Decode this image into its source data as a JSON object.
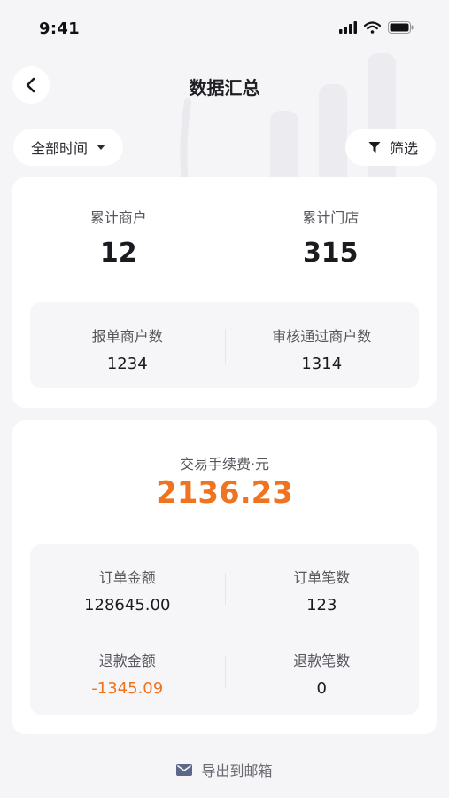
{
  "status_bar": {
    "time": "9:41"
  },
  "header": {
    "title": "数据汇总"
  },
  "filters": {
    "time_range": "全部时间",
    "filter_label": "筛选"
  },
  "summary": {
    "total_merchants_label": "累计商户",
    "total_merchants_value": "12",
    "total_stores_label": "累计门店",
    "total_stores_value": "315",
    "submitted_label": "报单商户数",
    "submitted_value": "1234",
    "approved_label": "审核通过商户数",
    "approved_value": "1314"
  },
  "transactions": {
    "fee_label": "交易手续费·元",
    "fee_value": "2136.23",
    "order_amount_label": "订单金额",
    "order_amount_value": "128645.00",
    "order_count_label": "订单笔数",
    "order_count_value": "123",
    "refund_amount_label": "退款金额",
    "refund_amount_value": "-1345.09",
    "refund_count_label": "退款笔数",
    "refund_count_value": "0"
  },
  "footer": {
    "export_label": "导出到邮箱"
  },
  "colors": {
    "accent": "#f0731f",
    "background": "#f5f5f7"
  }
}
